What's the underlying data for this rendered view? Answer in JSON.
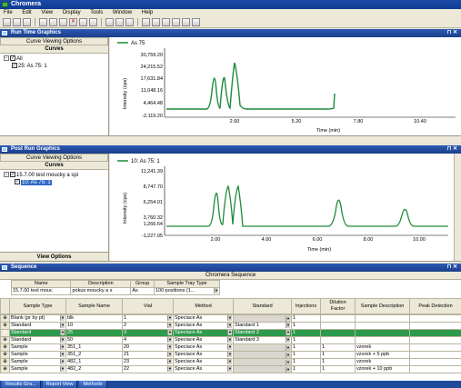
{
  "app": {
    "title": "Chromera"
  },
  "menu": [
    "File",
    "Edit",
    "View",
    "Display",
    "Tools",
    "Window",
    "Help"
  ],
  "runtime": {
    "title": "Run Time Graphics",
    "curve_options": "Curve Viewing Options",
    "curves_label": "Curves",
    "tree_root": "All",
    "tree_child": "25: As 75: 1",
    "legend": "As 75",
    "ylabel": "Intensity (cps)",
    "xlabel": "Time (min)",
    "yticks": [
      "30,759.20",
      "24,215.52",
      "17,631.84",
      "11,048.16",
      "4,464.48",
      "-2,119.20"
    ],
    "xticks": [
      "2.60",
      "5.20",
      "7.80",
      "10.40"
    ]
  },
  "postrun": {
    "title": "Post Run Graphics",
    "curve_options": "Curve Viewing Options",
    "curves_label": "Curves",
    "tree_root": "15.7.00 test moucky a spi",
    "tree_child": "10: As 75: 1",
    "legend": "10: As 75: 1",
    "ylabel": "Intensity (cps)",
    "xlabel": "Time (min)",
    "yticks": [
      "11,241.39",
      "8,747.70",
      "6,254.01",
      "3,760.32",
      "1,266.64",
      "-1,227.05"
    ],
    "xticks": [
      "2.00",
      "4.00",
      "6.00",
      "8.00",
      "10.00"
    ],
    "view_options": "View Options"
  },
  "sequence": {
    "title": "Sequence",
    "grid_title": "Chromera Sequence",
    "info_headers": [
      "Name",
      "Description",
      "Group",
      "Sample Tray Type"
    ],
    "info_values": [
      "15.7.00 test mouc",
      "pokus moucky a s",
      "As",
      "100 positions (1..."
    ],
    "columns": [
      "Sample Type",
      "Sample Name",
      "Vial",
      "Method",
      "Standard",
      "Injections",
      "Dilution Factor",
      "Sample Description",
      "Peak Detection"
    ],
    "rows": [
      [
        "Blank (pr by pt)",
        "blk",
        "1",
        "Speciace As",
        "",
        "1",
        "",
        "",
        ""
      ],
      [
        "Standard",
        "10",
        "2",
        "Speciace As",
        "Standard 1",
        "1",
        "",
        "",
        ""
      ],
      [
        "Standard",
        "25",
        "3",
        "Speciace As",
        "Standard 2",
        "1",
        "",
        "",
        ""
      ],
      [
        "Standard",
        "50",
        "4",
        "Speciace As",
        "Standard 3",
        "1",
        "",
        "",
        ""
      ],
      [
        "Sample",
        "351_1",
        "20",
        "Speciace As",
        "",
        "1",
        "1",
        "vzorek",
        ""
      ],
      [
        "Sample",
        "351_2",
        "21",
        "Speciace As",
        "",
        "1",
        "1",
        "vzorek + 5 ppb",
        ""
      ],
      [
        "Sample",
        "482_1",
        "23",
        "Speciace As",
        "",
        "1",
        "1",
        "vzorek",
        ""
      ],
      [
        "Sample",
        "482_2",
        "22",
        "Speciace As",
        "",
        "1",
        "1",
        "vzorek + 10 ppb",
        ""
      ]
    ],
    "highlight_row": 2
  },
  "taskbar": [
    "Results Gra...",
    "Report View",
    "Methods"
  ],
  "colors": {
    "trace": "#1e8a3a",
    "highlight": "#2e9a4b",
    "panel_header": "#1f4496"
  },
  "icons": [
    "app-icon",
    "pin-icon",
    "close-icon",
    "expand-icon",
    "checkbox-icon",
    "dropdown-icon"
  ]
}
